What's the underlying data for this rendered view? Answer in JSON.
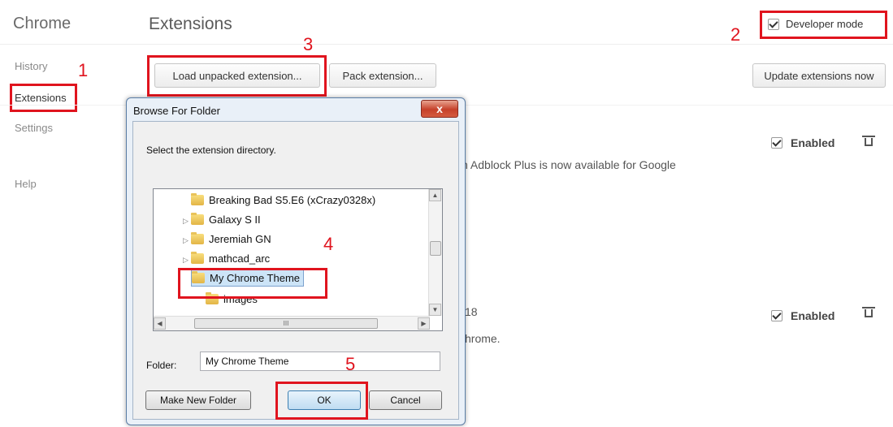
{
  "sidebar": {
    "brand": "Chrome",
    "items": [
      {
        "label": "History"
      },
      {
        "label": "Extensions"
      },
      {
        "label": "Settings"
      },
      {
        "label": "Help"
      }
    ]
  },
  "header": {
    "title": "Extensions",
    "developer_mode_label": "Developer mode",
    "load_unpacked_label": "Load unpacked extension...",
    "pack_label": "Pack extension...",
    "update_label": "Update extensions now"
  },
  "extensions": [
    {
      "enabled_label": "Enabled",
      "description_fragment": "n Adblock Plus is now available for Google"
    },
    {
      "enabled_label": "Enabled",
      "description_fragment_1": "18",
      "description_fragment_2": "hrome."
    }
  ],
  "annotations": {
    "n1": "1",
    "n2": "2",
    "n3": "3",
    "n4": "4",
    "n5": "5"
  },
  "dialog": {
    "title": "Browse For Folder",
    "close_glyph": "x",
    "instruction": "Select the extension directory.",
    "tree": [
      {
        "label": "Breaking Bad S5.E6 (xCrazy0328x)"
      },
      {
        "label": "Galaxy S II"
      },
      {
        "label": "Jeremiah GN"
      },
      {
        "label": "mathcad_arc"
      },
      {
        "label": "My Chrome Theme"
      },
      {
        "label": "images"
      }
    ],
    "hscroll_thumb_glyph": "III",
    "folder_label": "Folder:",
    "folder_value": "My Chrome Theme",
    "make_new_folder_label": "Make New Folder",
    "ok_label": "OK",
    "cancel_label": "Cancel"
  },
  "colors": {
    "annotation_red": "#e0141e",
    "dialog_border": "#5b7ea6"
  }
}
